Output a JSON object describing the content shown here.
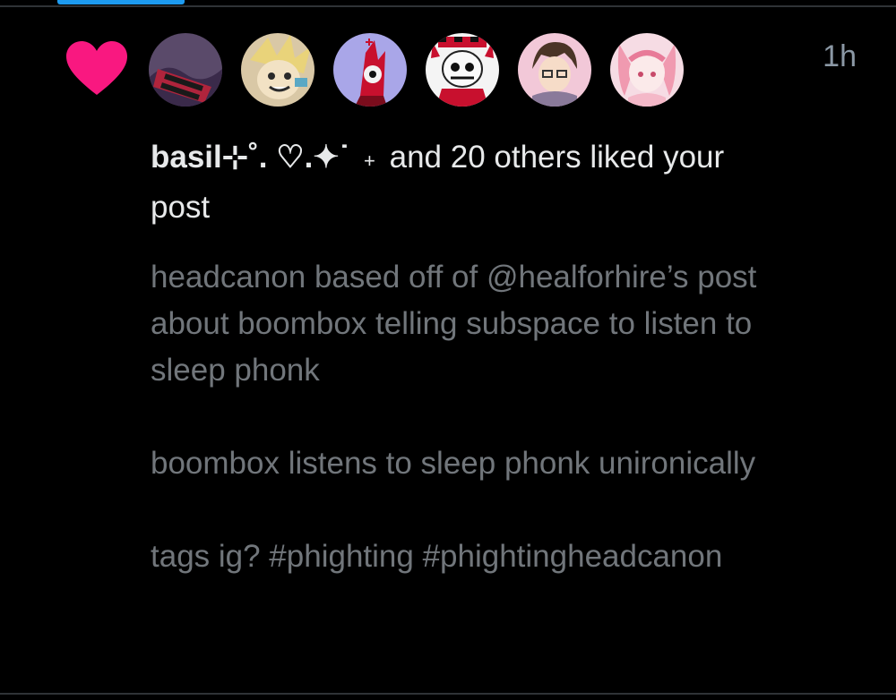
{
  "colors": {
    "background": "#000000",
    "heart": "#f91880",
    "accent": "#1d9bf0",
    "primary_text": "#e7e9ea",
    "secondary_text": "#71767b"
  },
  "notification": {
    "icon": "heart-icon",
    "timestamp": "1h",
    "avatars": [
      {
        "label": "avatar-1"
      },
      {
        "label": "avatar-2"
      },
      {
        "label": "avatar-3"
      },
      {
        "label": "avatar-4"
      },
      {
        "label": "avatar-5"
      },
      {
        "label": "avatar-6"
      }
    ],
    "actor_name": "basil⊹˚. ♡.✦˙",
    "separator": "+",
    "summary": "and 20 others liked your post",
    "post_paragraphs": [
      "headcanon based off of @healforhire’s post about boombox telling subspace to listen to sleep phonk",
      "boombox listens to sleep phonk unironically",
      "tags ig? #phighting #phightingheadcanon"
    ]
  }
}
